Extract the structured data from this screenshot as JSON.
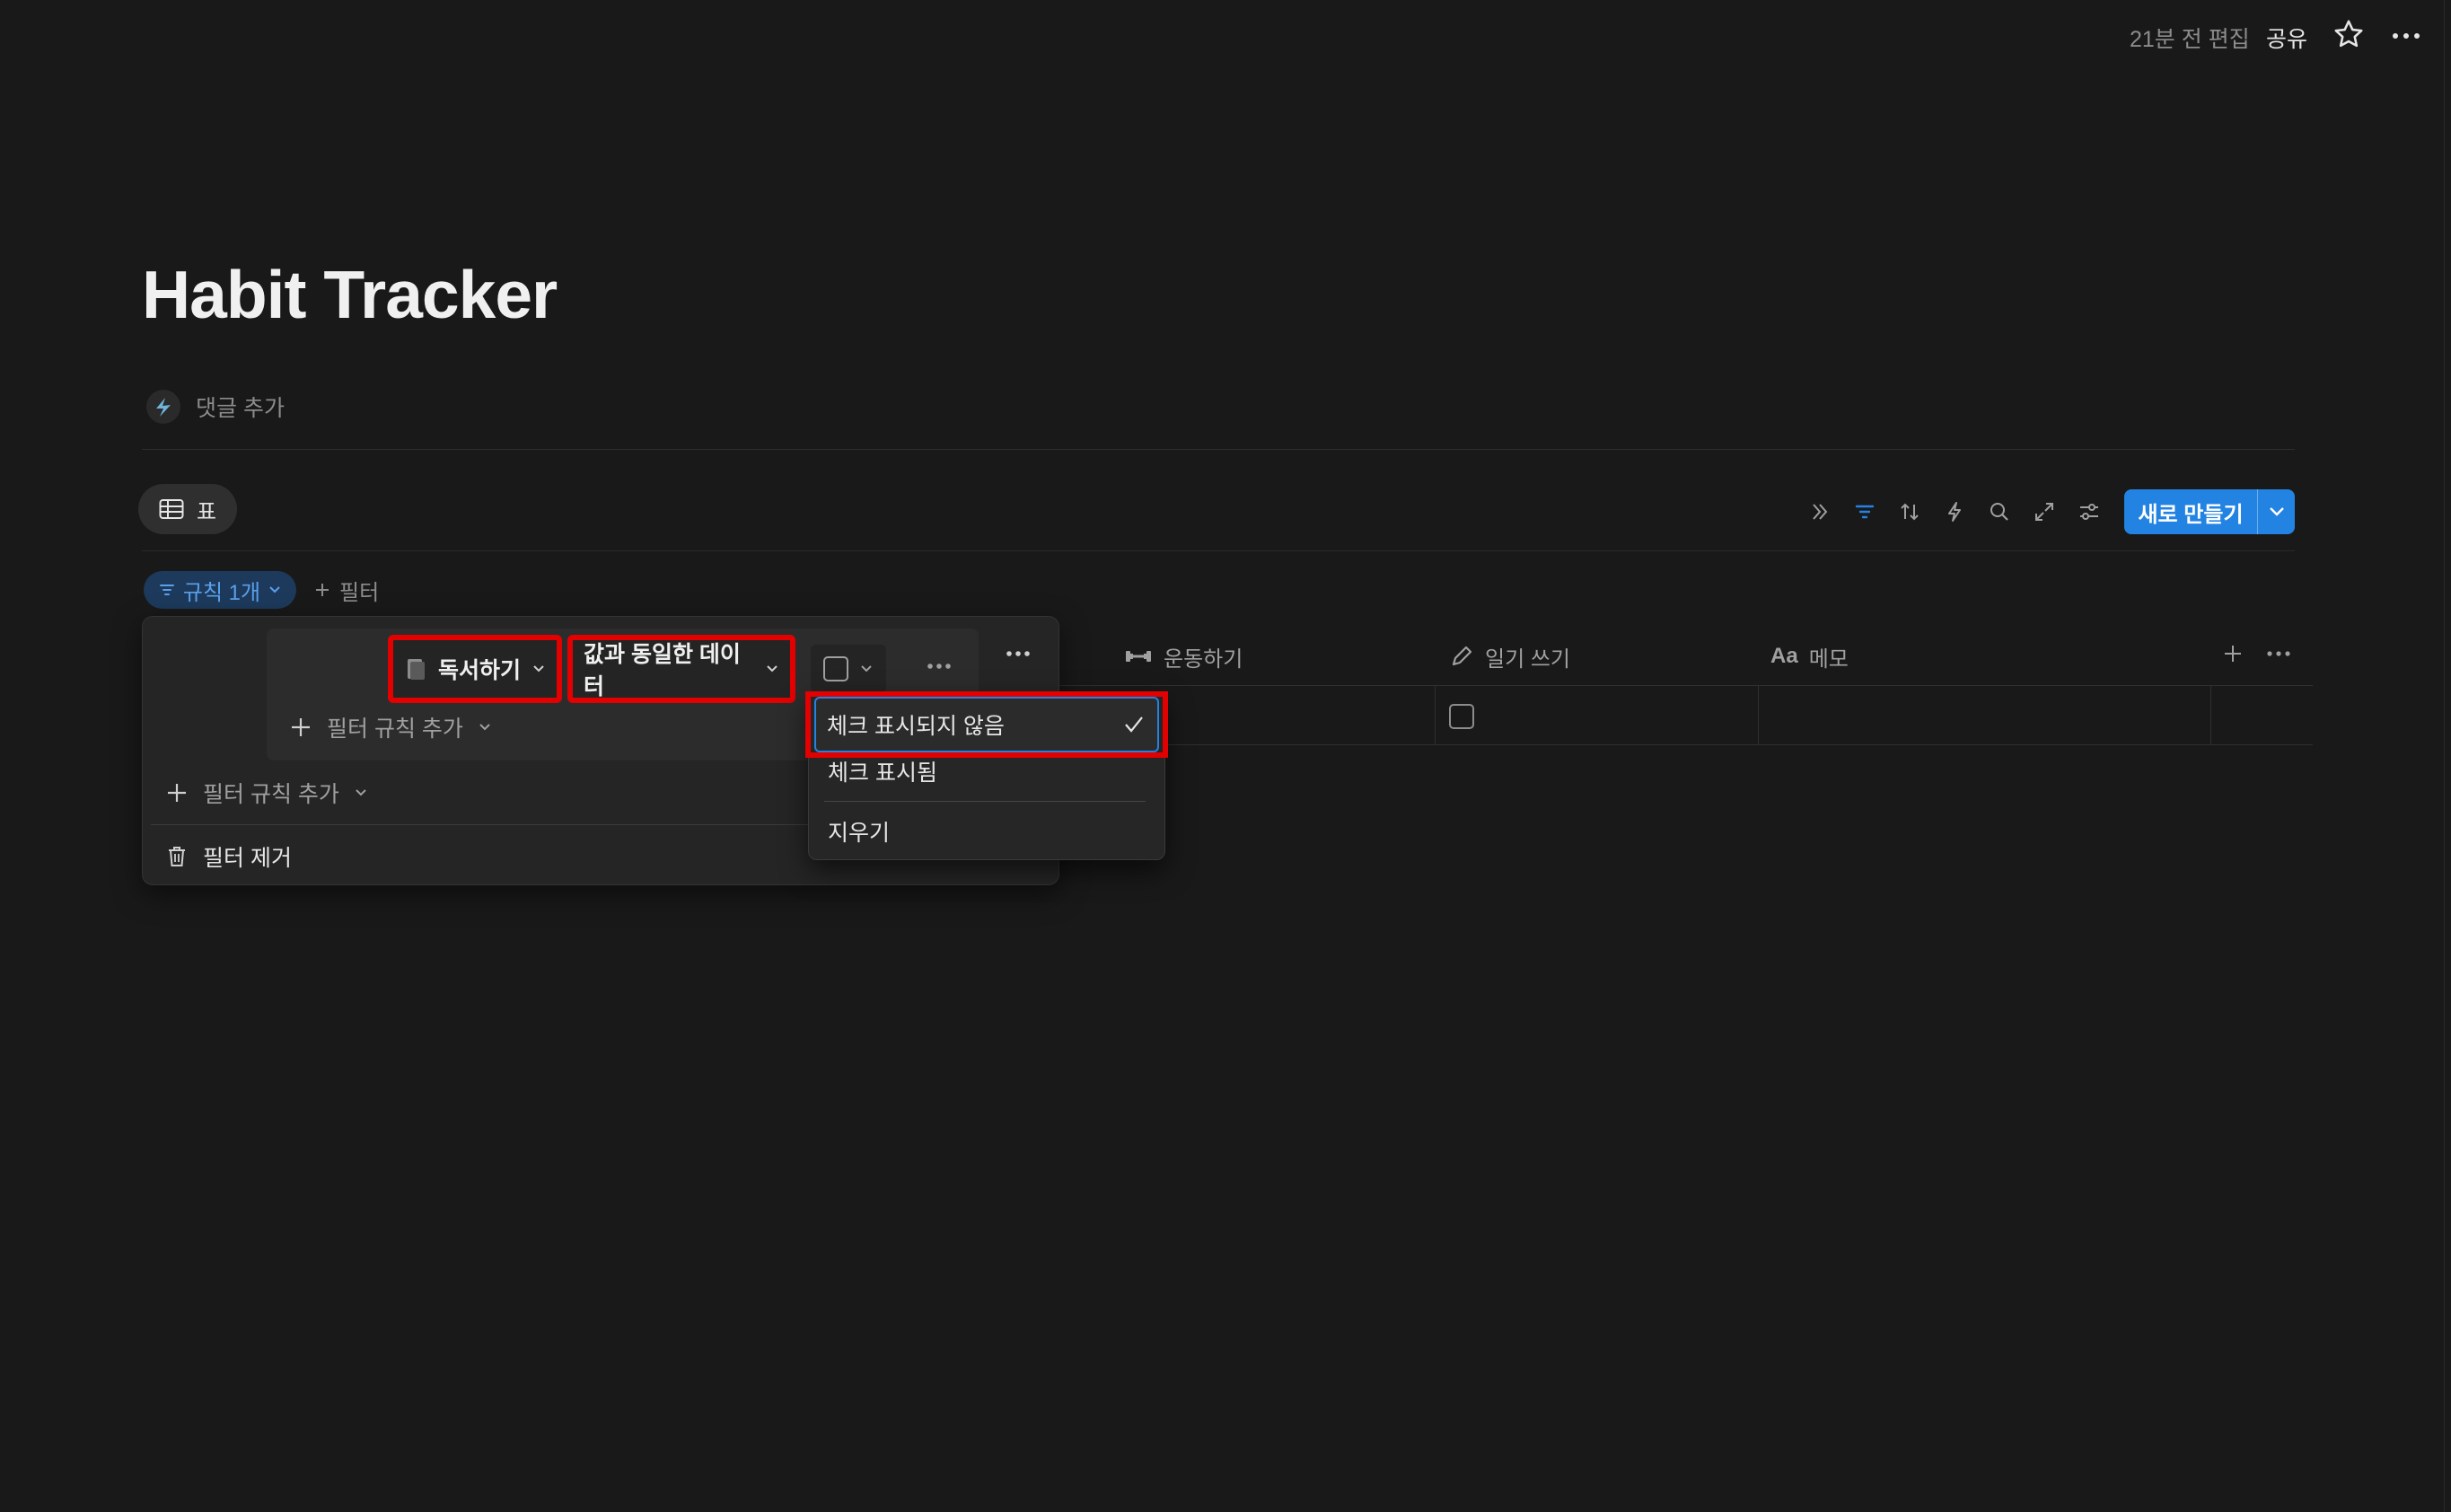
{
  "topbar": {
    "edited": "21분 전 편집",
    "share": "공유",
    "star_icon": "star-icon",
    "more_icon": "more-horizontal-icon"
  },
  "page": {
    "title": "Habit Tracker",
    "add_comment": "댓글 추가"
  },
  "views": {
    "tabs": [
      {
        "label": "표",
        "icon": "table-icon",
        "active": true
      }
    ]
  },
  "toolbar": {
    "icons": [
      "double-chevron-right-icon",
      "filter-icon",
      "sort-icon",
      "lightning-icon",
      "search-icon",
      "expand-icon",
      "settings-sliders-icon"
    ],
    "new_button": "새로 만들기"
  },
  "filter_bar": {
    "rule_chip": "규칙 1개",
    "add_filter": "필터"
  },
  "table": {
    "columns": [
      {
        "label": "운동하기",
        "icon": "dumbbell-icon"
      },
      {
        "label": "일기 쓰기",
        "icon": "pencil-icon"
      },
      {
        "label": "메모",
        "icon": "text-aa-icon",
        "icon_text": "Aa"
      }
    ]
  },
  "filter_popover": {
    "property": "독서하기",
    "operator": "값과 동일한 데이터",
    "add_rule_inner": "필터 규칙 추가",
    "add_rule_outer": "필터 규칙 추가",
    "remove_filter": "필터 제거"
  },
  "value_menu": {
    "options": [
      "체크 표시되지 않음",
      "체크 표시됨"
    ],
    "selected": "체크 표시되지 않음",
    "clear": "지우기"
  },
  "colors": {
    "accent": "#2383e2",
    "highlight": "#e30000",
    "background": "#191919"
  }
}
